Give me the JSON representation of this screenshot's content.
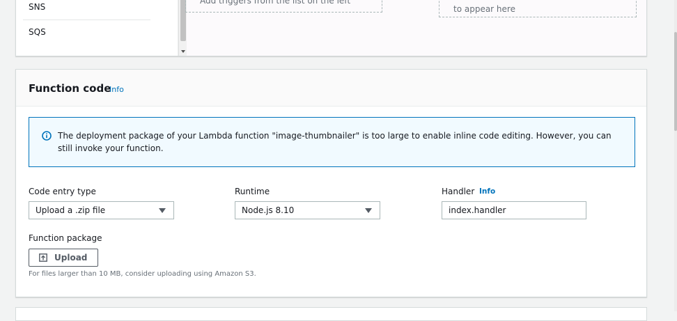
{
  "triggers": {
    "items": [
      "SNS",
      "SQS"
    ],
    "add_hint": "Add triggers from the list on the left",
    "appear_hint": "to appear here"
  },
  "function_code": {
    "title": "Function code",
    "info_link": "Info",
    "alert_text": "The deployment package of your Lambda function \"image-thumbnailer\" is too large to enable inline code editing. However, you can still invoke your function.",
    "code_entry_type": {
      "label": "Code entry type",
      "selected": "Upload a .zip file"
    },
    "runtime": {
      "label": "Runtime",
      "selected": "Node.js 8.10"
    },
    "handler": {
      "label": "Handler",
      "info_link": "Info",
      "value": "index.handler"
    },
    "function_package": {
      "label": "Function package",
      "upload_label": "Upload",
      "hint": "For files larger than 10 MB, consider uploading using Amazon S3."
    }
  },
  "colors": {
    "link": "#0073bb",
    "alert_border": "#0073bb",
    "alert_bg": "#f1faff",
    "page_bg": "#f2f3f3"
  }
}
